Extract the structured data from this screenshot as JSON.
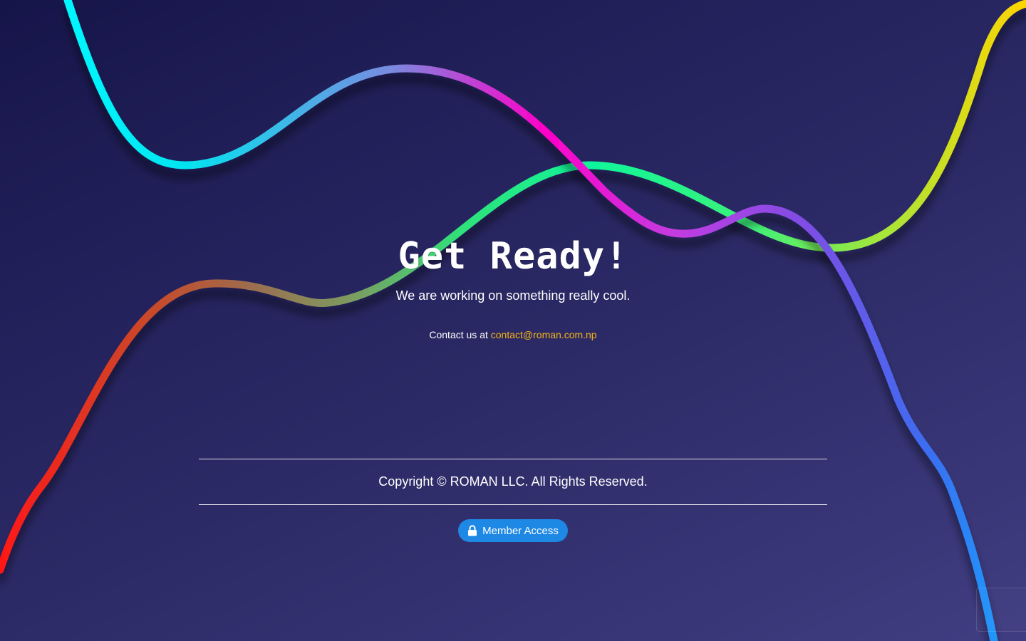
{
  "hero": {
    "title": "Get Ready!",
    "subtitle": "We are working on something really cool."
  },
  "contact": {
    "prefix": "Contact us at ",
    "email": "contact@roman.com.np",
    "email_color": "#f5b516"
  },
  "footer": {
    "copyright": "Copyright © ROMAN LLC. All Rights Reserved."
  },
  "member_button": {
    "label": "Member Access",
    "icon": "lock-icon",
    "color": "#1e88e5"
  },
  "colors": {
    "background_dark": "#16154a",
    "background_light": "#403d82",
    "wave_cyan": "#00f0ff",
    "wave_magenta": "#ff00c8",
    "wave_green": "#1cf59a",
    "wave_red": "#ff1a1a",
    "wave_yellow": "#ffd400",
    "wave_blue": "#13a8ff"
  }
}
